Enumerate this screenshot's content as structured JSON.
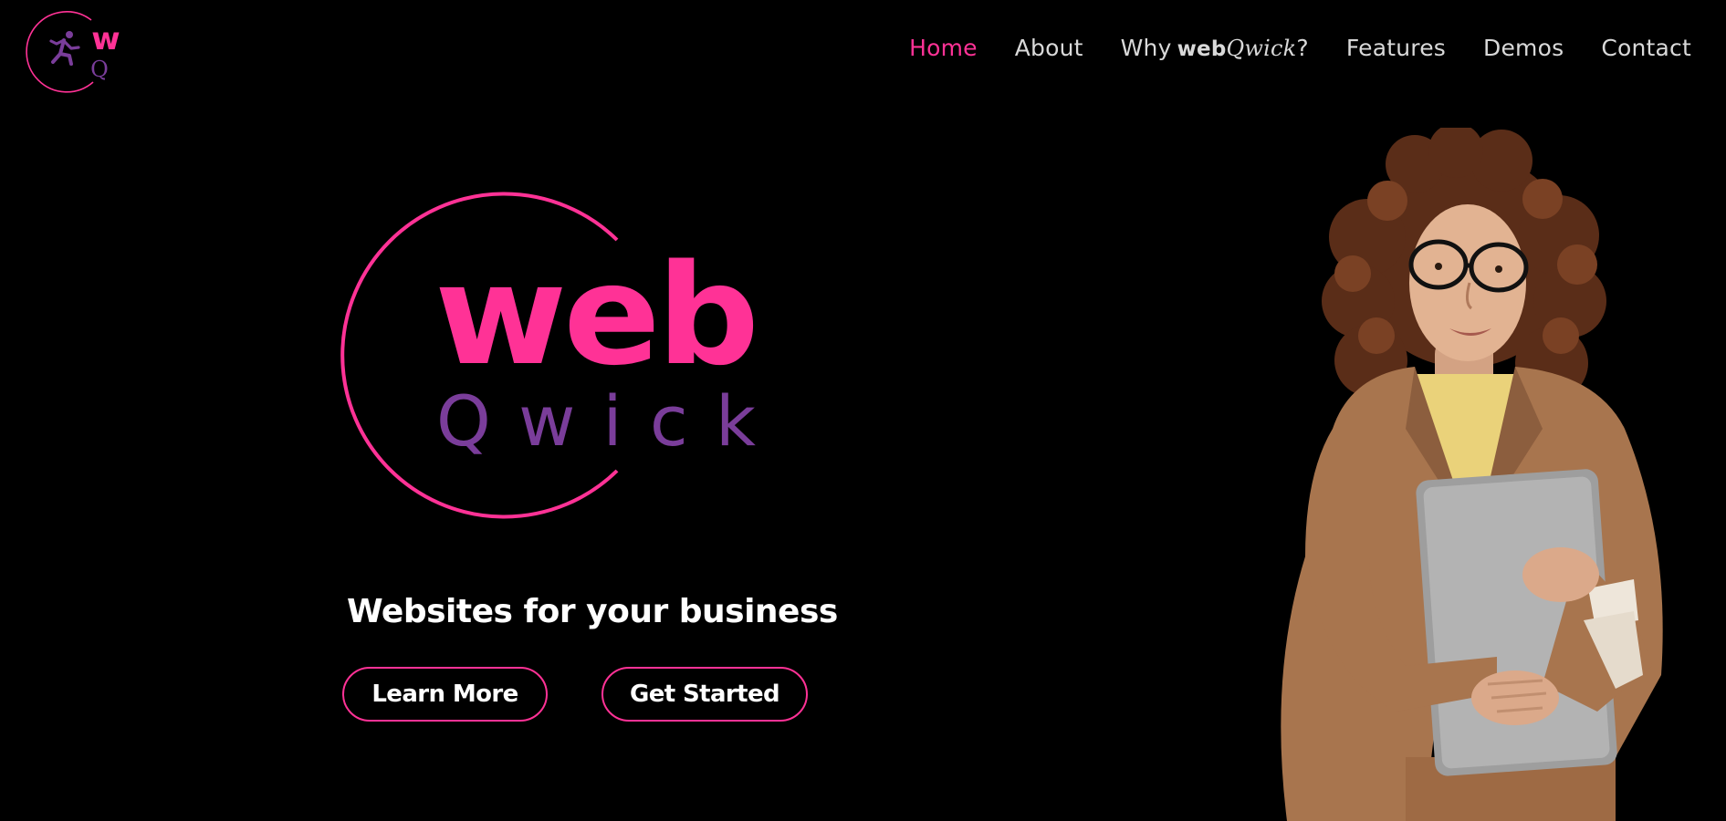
{
  "brand": {
    "logo_main": "web",
    "logo_sub": "Qwick",
    "nav_logo_main": "w",
    "nav_logo_sub": "Q",
    "colors": {
      "pink": "#ff3296",
      "purple": "#7a3d9a",
      "background": "#000000",
      "nav_text": "#d9d9d9"
    }
  },
  "nav": {
    "home": "Home",
    "about": "About",
    "why_prefix": "Why",
    "why_brand_web": "web",
    "why_brand_qwick": "Qwick",
    "why_suffix": "?",
    "features": "Features",
    "demos": "Demos",
    "contact": "Contact",
    "active": "Home"
  },
  "hero": {
    "tagline": "Websites for your business",
    "learn_more": "Learn More",
    "get_started": "Get Started",
    "photo_icon": "woman-holding-laptop-photo"
  }
}
